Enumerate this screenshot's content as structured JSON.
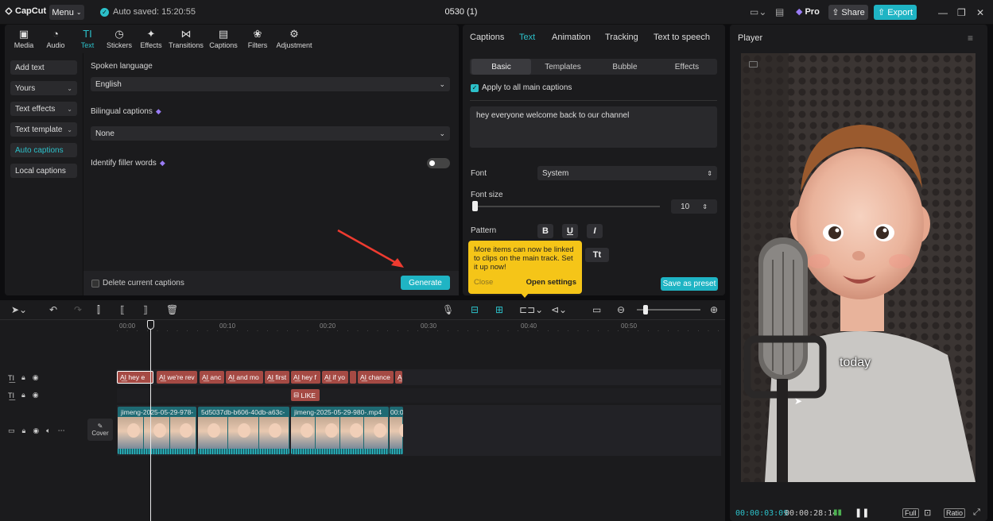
{
  "app": {
    "logo": "CapCut",
    "menu_label": "Menu",
    "autosave": "Auto saved: 15:20:55",
    "project_title": "0530 (1)",
    "pro_label": "Pro",
    "share_label": "Share",
    "export_label": "Export"
  },
  "toolbar": {
    "tools": [
      "Media",
      "Audio",
      "Text",
      "Stickers",
      "Effects",
      "Transitions",
      "Captions",
      "Filters",
      "Adjustment"
    ],
    "active": "Text"
  },
  "sidebar": {
    "items": [
      "Add text",
      "Yours",
      "Text effects",
      "Text template",
      "Auto captions",
      "Local captions"
    ]
  },
  "auto_captions": {
    "spoken_language_label": "Spoken language",
    "spoken_language_value": "English",
    "bilingual_label": "Bilingual captions",
    "bilingual_value": "None",
    "filler_label": "Identify filler words",
    "delete_label": "Delete current captions",
    "generate_label": "Generate"
  },
  "inspector": {
    "tabs": [
      "Captions",
      "Text",
      "Animation",
      "Tracking",
      "Text to speech"
    ],
    "active_tab": "Text",
    "subtabs": [
      "Basic",
      "Templates",
      "Bubble",
      "Effects"
    ],
    "active_subtab": "Basic",
    "apply_all_label": "Apply to all main captions",
    "caption_text": "hey everyone welcome back to our channel",
    "font_label": "Font",
    "font_value": "System",
    "font_size_label": "Font size",
    "font_size_value": "10",
    "pattern_label": "Pattern",
    "pattern_buttons": [
      "B",
      "U",
      "I"
    ],
    "case_button": "Tt",
    "save_preset_label": "Save as preset",
    "tooltip": {
      "message": "More items can now be linked to clips on the main track. Set it up now!",
      "close_label": "Close",
      "open_label": "Open settings"
    }
  },
  "player": {
    "title": "Player",
    "caption_overlay": "today",
    "current_time": "00:00:03:09",
    "total_time": "00:00:28:14",
    "full_label": "Full",
    "ratio_label": "Ratio"
  },
  "timeline": {
    "ruler": [
      "00:00",
      "00:10",
      "00:20",
      "00:30",
      "00:40",
      "00:50"
    ],
    "caption_clips": [
      "hey e",
      "we're rev",
      "anc",
      "and mo",
      "first",
      "hey f",
      "if yo",
      "chance"
    ],
    "sticker_clip": "LIKE",
    "video_clips": [
      "jimeng-2025-05-29-978-",
      "5d5037db-b606-40db-a63c-",
      "jimeng-2025-05-29-980-.mp4",
      "00:0"
    ],
    "cover_label": "Cover"
  },
  "colors": {
    "accent": "#1fb4c4",
    "caption_clip": "#a54a44",
    "video_clip": "#1e6a73",
    "tooltip": "#f5c518"
  }
}
